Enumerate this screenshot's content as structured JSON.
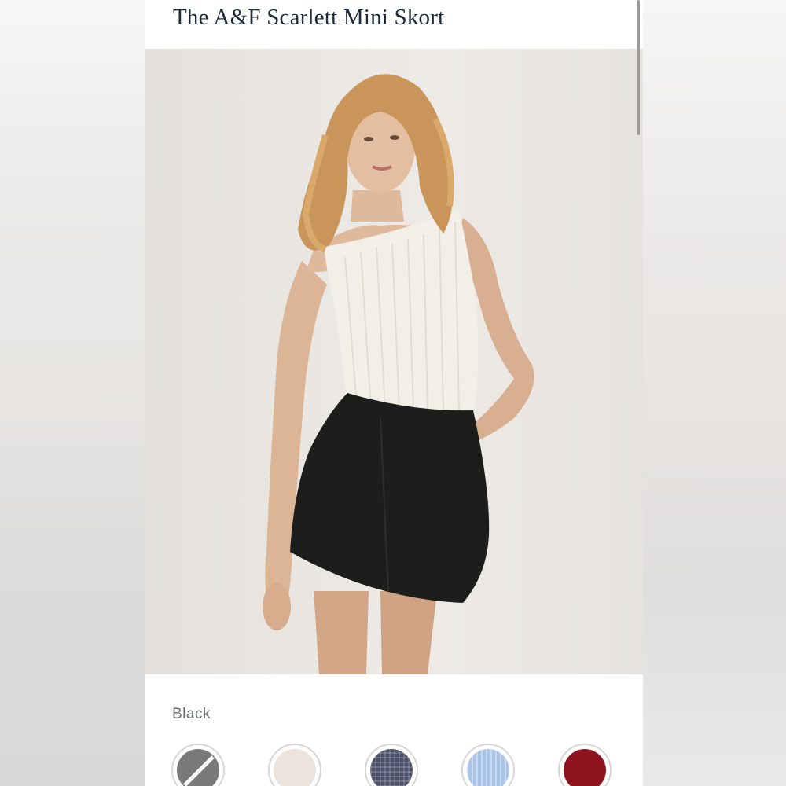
{
  "product": {
    "title": "The A&F Scarlett Mini Skort"
  },
  "carousel": {
    "current_slide": 1,
    "progress_fraction": 0.17
  },
  "color_selector": {
    "selected_label": "Black",
    "swatches": [
      {
        "name": "black",
        "color": "#7a7a7a",
        "selected": true
      },
      {
        "name": "cream",
        "color": "#ebe3dc",
        "selected": false
      },
      {
        "name": "navy-plaid",
        "color": "#4a4e66",
        "selected": false
      },
      {
        "name": "light-blue-stripe",
        "color": "#a9c4e6",
        "selected": false
      },
      {
        "name": "burgundy",
        "color": "#8e1520",
        "selected": false
      }
    ]
  },
  "colors": {
    "title_text": "#1e2a3a",
    "progress_bar": "#263547",
    "label_text": "#6a6f75"
  }
}
